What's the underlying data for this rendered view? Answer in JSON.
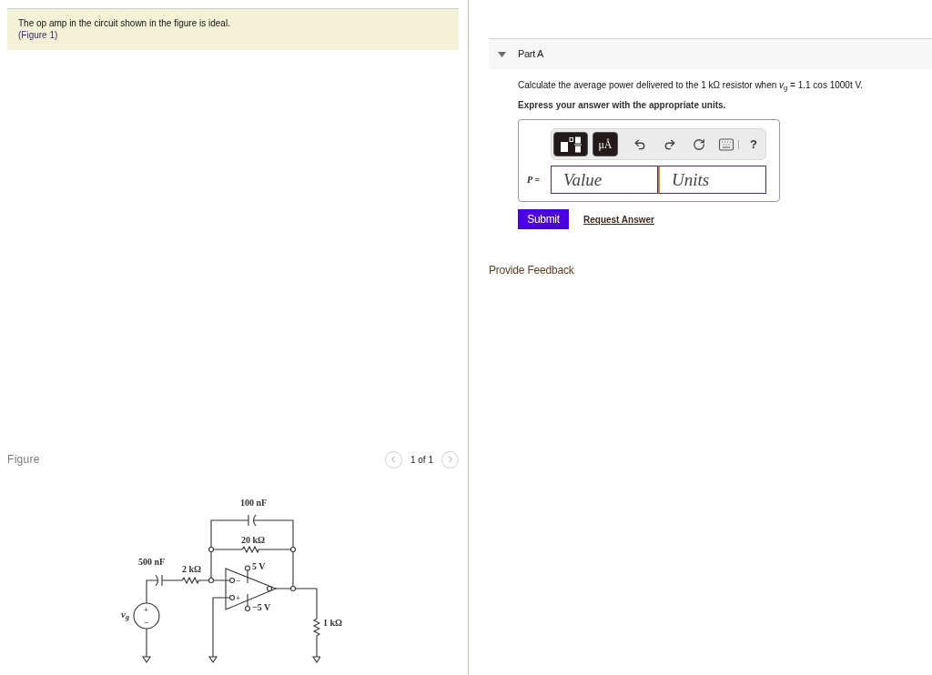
{
  "problem": {
    "text": "The op amp in the circuit shown in the figure is ideal.",
    "figure_link": "(Figure 1)"
  },
  "figure_panel": {
    "title": "Figure",
    "page_count": "1 of 1",
    "circuit_labels": {
      "capacitor_top": "100 nF",
      "resistor_feedback": "20 kΩ",
      "capacitor_input": "500 nF",
      "resistor_input": "2 kΩ",
      "supply_positive": "5 V",
      "supply_negative": "−5 V",
      "load_resistor": "1 kΩ",
      "source": "v$_{g}$",
      "source_plus": "+",
      "source_minus": "−",
      "opamp_minus": "−",
      "opamp_plus": "+"
    }
  },
  "part": {
    "title": "Part A",
    "expanded": true,
    "question": "Calculate the average power delivered to the 1 kΩ resistor when *v*$_{g}$ = 1.1 cos 1000t V.",
    "instruction": "Express your answer with the appropriate units.",
    "toolbar": {
      "units_button": "μÅ",
      "help_button": "?"
    },
    "answer": {
      "variable": "*P* =",
      "value_placeholder": "Value",
      "units_placeholder": "Units"
    },
    "submit": "Submit",
    "request_answer": "Request Answer"
  },
  "feedback_link": "Provide Feedback"
}
